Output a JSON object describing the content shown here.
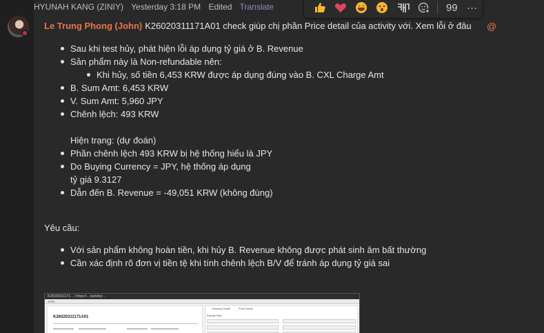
{
  "header": {
    "author": "HYUNAH KANG (ZINIY)",
    "time": "Yesterday 3:18 PM",
    "edited": "Edited",
    "translate": "Translate"
  },
  "reactions": [
    "like",
    "heart",
    "laugh",
    "surprised",
    "sad-korean",
    "add-reaction"
  ],
  "reaction_bar": {
    "reply": "99",
    "more": "···"
  },
  "message": {
    "mention": "Le Trung Phong (John)",
    "subject": "K26020311171A01 check giúp chị phần Price detail của activity với. Xem lỗi ở đâu",
    "at_symbol": "@",
    "bullets1": [
      "Sau khi test hủy, phát hiện lỗi áp dụng tỷ giá ở B. Revenue",
      "Sản phẩm này là Non-refundable nên:"
    ],
    "sub_bullet": "Khi hủy, số tiền 6,453 KRW được áp dụng đúng vào B. CXL Charge Amt",
    "bullets2": [
      "B. Sum Amt: 6,453 KRW",
      "V. Sum Amt: 5,960 JPY",
      "Chênh lệch: 493 KRW"
    ],
    "status_label": "Hiện trạng: (dự đoán)",
    "bullets3": [
      "Phần chênh lệch 493 KRW bị hệ thống hiểu là JPY",
      "Do Buying Currency = JPY, hệ thống áp dụng",
      "Dẫn đến B. Revenue = -49,051 KRW (không đúng)"
    ],
    "bullet3_continuation": "tỷ giá 9.3127",
    "request_label": "Yêu cầu:",
    "bullets4": [
      "Với sản phẩm không hoàn tiền, khi hủy B. Revenue không được phát sinh âm bất thường",
      "Cần xác định rõ đơn vị tiền tệ khi tính chênh lệch B/V để tránh áp dụng tỷ giá sai"
    ]
  },
  "attachment": {
    "top_bar": "K26020311171...    |   https://…/activity/…",
    "tab": "JPRB",
    "booking_id": "K26020311171A01",
    "right_tab1": "Booking Detail",
    "right_tab2": "Price Detail",
    "section": "Buying Rate"
  }
}
